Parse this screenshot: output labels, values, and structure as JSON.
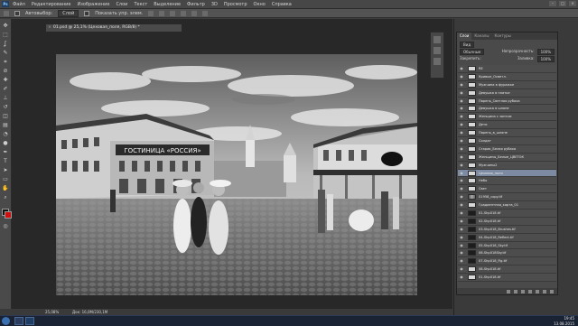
{
  "menu": {
    "app_icon": "Ps",
    "items": [
      "Файл",
      "Редактирование",
      "Изображение",
      "Слои",
      "Текст",
      "Выделение",
      "Фильтр",
      "3D",
      "Просмотр",
      "Окно",
      "Справка"
    ]
  },
  "options": {
    "autoselect_label": "Автовыбор:",
    "autoselect_value": "Слой",
    "show_controls_label": "Показать упр. элем."
  },
  "document": {
    "tab_title": "01.psd @ 25,1% (Цеховая_поля, RGB/8) *",
    "photo_sign": "ГОСТИНИЦА «РОССИЯ»"
  },
  "layers_panel": {
    "tabs": [
      "Слои",
      "Каналы",
      "Контуры"
    ],
    "kind_label": "Вид",
    "blend_mode": "Обычные",
    "opacity_label": "Непрозрачность:",
    "opacity_value": "100%",
    "lock_label": "Закрепить:",
    "fill_label": "Заливка:",
    "fill_value": "100%",
    "layers": [
      {
        "name": "RE",
        "thumb": "light",
        "selected": false
      },
      {
        "name": "Кривые_Осветл.",
        "thumb": "light",
        "selected": false
      },
      {
        "name": "Мужчина в фуражке",
        "thumb": "light",
        "selected": false
      },
      {
        "name": "Девушка в платье",
        "thumb": "light",
        "selected": false
      },
      {
        "name": "Парень_Светлая рубаха",
        "thumb": "light",
        "selected": false
      },
      {
        "name": "Девушка в шляпе",
        "thumb": "light",
        "selected": false
      },
      {
        "name": "Женщина с зонтом",
        "thumb": "light",
        "selected": false
      },
      {
        "name": "Дети",
        "thumb": "light",
        "selected": false
      },
      {
        "name": "Парень_в_шляпе",
        "thumb": "light",
        "selected": false
      },
      {
        "name": "Солдат",
        "thumb": "light",
        "selected": false
      },
      {
        "name": "Старик_Белая рубаха",
        "thumb": "light",
        "selected": false
      },
      {
        "name": "Женщины_Белые_ЦВЕТОК",
        "thumb": "light",
        "selected": false
      },
      {
        "name": "Мужчины2",
        "thumb": "light",
        "selected": false
      },
      {
        "name": "Цеховая_поля",
        "thumb": "light",
        "selected": true
      },
      {
        "name": "Небо",
        "thumb": "light",
        "selected": false
      },
      {
        "name": "Свет",
        "thumb": "light",
        "selected": false
      },
      {
        "name": "01958_copy.tif",
        "thumb": "photo",
        "selected": false
      },
      {
        "name": "Градиентная_карта_01",
        "thumb": "light",
        "selected": false
      },
      {
        "name": "01-Shp018.tif",
        "thumb": "dark",
        "selected": false
      },
      {
        "name": "02-Shp018.tif",
        "thumb": "dark",
        "selected": false
      },
      {
        "name": "03-Shp018_Brushes.tif",
        "thumb": "dark",
        "selected": false
      },
      {
        "name": "04-Shp018_Reflect.tif",
        "thumb": "dark",
        "selected": false
      },
      {
        "name": "05-Shp018_Sky.tif",
        "thumb": "dark",
        "selected": false
      },
      {
        "name": "06-Shp018Sky.tif",
        "thumb": "dark",
        "selected": false
      },
      {
        "name": "07-Shp018_Fig.tif",
        "thumb": "dark",
        "selected": false
      },
      {
        "name": "08-Shp018.tif",
        "thumb": "light",
        "selected": false
      },
      {
        "name": "01-Shp018.tif",
        "thumb": "light",
        "selected": false
      }
    ]
  },
  "status": {
    "zoom": "25,08%",
    "doc_size": "Док: 16,0M/230,1M"
  },
  "taskbar": {
    "time": "19:45",
    "date": "13.08.2015"
  }
}
